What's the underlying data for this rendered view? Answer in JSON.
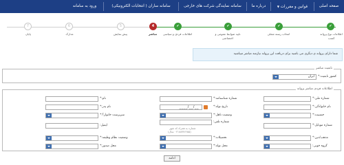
{
  "nav": {
    "items": [
      "صفحه اصلی",
      "قوانین و مقررات",
      "درباره ما",
      "سامانه نمایندگی شرکت های خارجی",
      "سامانه ساران ( انتخابات الکترونیکی)",
      "ورود به سامانه"
    ]
  },
  "steps": [
    {
      "label": "اطلاعات نوع پروانه کسب",
      "state": "done",
      "num": ""
    },
    {
      "label": "انتخاب رسته شغلی",
      "state": "done",
      "num": ""
    },
    {
      "label": "تایید ضوابط عمومی و اختصاصی",
      "state": "done",
      "num": ""
    },
    {
      "label": "اطلاعات فردی و سیاسی",
      "state": "done",
      "num": ""
    },
    {
      "label": "مباشر",
      "state": "current",
      "num": "4"
    },
    {
      "label": "پیش نمایش",
      "state": "todo",
      "num": "5"
    },
    {
      "label": "مدارک",
      "state": "todo",
      "num": "6"
    },
    {
      "label": "پایان",
      "state": "todo",
      "num": "7"
    }
  ],
  "info_text": "شما دارای پروانه ی دیگری می باشید برای دریافت این پروانه نیازمند مباشر میباشید",
  "nationality": {
    "legend": "تابعیت مباشر",
    "label": "کشور تابعیت:*",
    "value": "ایران"
  },
  "person": {
    "legend": "اطلاعات فردی مباشر پروانه",
    "national_id": "شماره ملی:*",
    "id_number": "شماره شناسنامه:*",
    "first_name": "نام:*",
    "last_name": "نام خانوادگی:*",
    "birth_date": "تاریخ تولد:*",
    "birth_date_value": "__/__/____",
    "father_name": "نام پدر:*",
    "gender": "جنسیت:*",
    "marital": "وضعیت تاهل:*",
    "household": "سرپرست خانوار؟:*",
    "mobile": "شماره موبایل:*",
    "phone": "شماره تلفن:",
    "phone_hint": "شماره به همراه کد شهر",
    "phone_hint2": "(۰۲۱۸۸۷۷۶۶۵۵ مثال)",
    "email": "ایمیل:",
    "religion": "مذهب/دین:*",
    "education": "تحصیلات:*",
    "military": "وضعیت نظام وظیفه:*",
    "blood": "گروه خونی:",
    "birth_place": "محل تولد:*",
    "issue_place": "محل صدور:*"
  },
  "submit": "ادامه",
  "colors": {
    "nav": "#1d3f85",
    "done": "#3a9f3a",
    "current": "#b52b2b",
    "select_arrow": "#3f6fb0"
  }
}
